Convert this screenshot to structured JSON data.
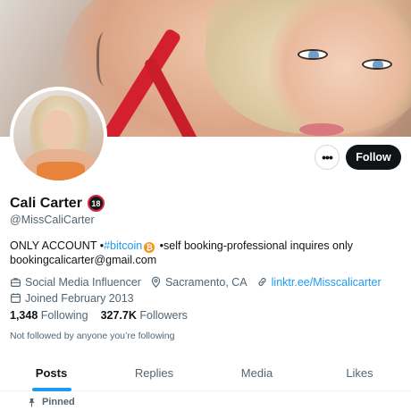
{
  "profile": {
    "name": "Cali Carter",
    "age_badge": "18",
    "handle": "@MissCaliCarter",
    "bio": {
      "part1": "ONLY ACCOUNT •",
      "hashtag": "#bitcoin",
      "part2": " •self booking-professional inquires only",
      "line2": "bookingcalicarter@gmail.com"
    },
    "category": "Social Media Influencer",
    "location": "Sacramento, CA",
    "website": "linktr.ee/Misscalicarter",
    "joined": "Joined February 2013",
    "following_count": "1,348",
    "following_label": "Following",
    "followers_count": "327.7K",
    "followers_label": "Followers",
    "not_followed": "Not followed by anyone you’re following"
  },
  "actions": {
    "more_label": "•••",
    "follow_label": "Follow"
  },
  "tabs": [
    {
      "label": "Posts",
      "active": true
    },
    {
      "label": "Replies",
      "active": false
    },
    {
      "label": "Media",
      "active": false
    },
    {
      "label": "Likes",
      "active": false
    }
  ],
  "pinned_label": "Pinned",
  "icons": {
    "bitcoin": "bitcoin-icon",
    "category": "briefcase-icon",
    "location": "location-pin-icon",
    "website": "link-icon",
    "joined": "calendar-icon",
    "pinned": "pin-icon"
  },
  "colors": {
    "accent": "#1d9bf0",
    "text": "#0f1419",
    "muted": "#536471",
    "follow_bg": "#0f1419"
  }
}
